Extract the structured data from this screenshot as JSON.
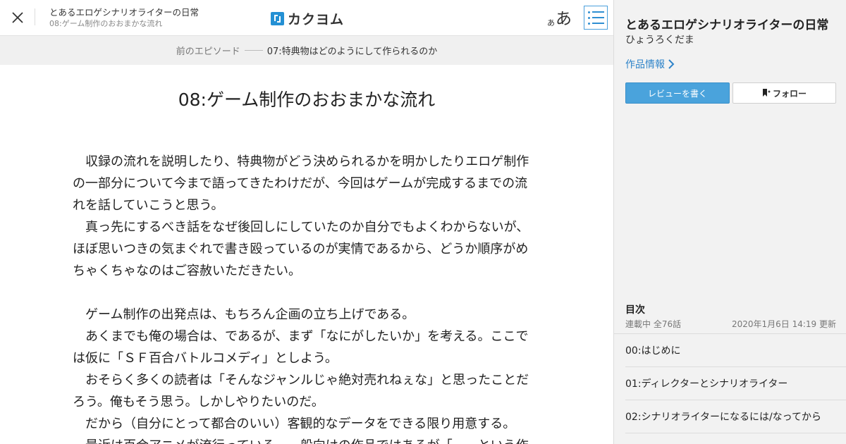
{
  "header": {
    "work_title": "とあるエロゲシナリオライターの日常",
    "episode_title": "08:ゲーム制作のおおまかな流れ",
    "logo_text": "カクヨム",
    "fontsize_small": "あ",
    "fontsize_large": "あ"
  },
  "prev_nav": {
    "label": "前のエピソード",
    "title": "07:特典物はどのようにして作られるのか"
  },
  "episode": {
    "heading": "08:ゲーム制作のおおまかな流れ",
    "paragraphs": [
      "　収録の流れを説明したり、特典物がどう決められるかを明かしたりエロゲ制作の一部分について今まで語ってきたわけだが、今回はゲームが完成するまでの流れを話していこうと思う。",
      "　真っ先にするべき話をなぜ後回しにしていたのか自分でもよくわからないが、ほぼ思いつきの気まぐれで書き殴っているのが実情であるから、どうか順序がめちゃくちゃなのはご容赦いただきたい。",
      "",
      "　ゲーム制作の出発点は、もちろん企画の立ち上げである。",
      "　あくまでも俺の場合は、であるが、まず「なにがしたいか」を考える。ここでは仮に「ＳＦ百合バトルコメディ」としよう。",
      "　おそらく多くの読者は「そんなジャンルじゃ絶対売れねぇな」と思ったことだろう。俺もそう思う。しかしやりたいのだ。",
      "　だから（自分にとって都合のいい）客観的なデータをできる限り用意する。",
      "　最近は百合アニメが流行っている。一般向けの作品ではあるが「……という作"
    ]
  },
  "sidebar": {
    "title": "とあるエロゲシナリオライターの日常",
    "author": "ひょうろくだま",
    "info_link": "作品情報",
    "review_button": "レビューを書く",
    "follow_button": "フォロー",
    "toc_heading": "目次",
    "toc_status": "連載中 全76話",
    "toc_updated": "2020年1月6日 14:19 更新",
    "toc_items": [
      "00:はじめに",
      "01:ディレクターとシナリオライター",
      "02:シナリオライターになるには/なってから"
    ]
  },
  "colors": {
    "accent": "#2f84c9",
    "review_button_bg": "#4aa3dc",
    "sidebar_bg": "#f2f2f2",
    "nav_bg": "#f0f0f0"
  },
  "icons": {
    "close": "close-icon",
    "toc": "list-icon",
    "chevron": "chevron-right-icon",
    "bookmark": "bookmark-plus-icon"
  }
}
